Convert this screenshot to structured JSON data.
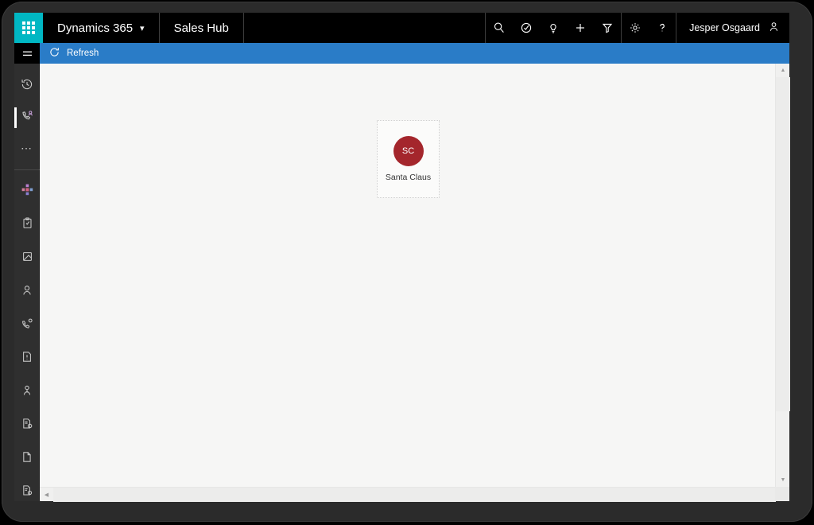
{
  "app": {
    "waffle_icon": "waffle-grid-icon",
    "brand": "Dynamics 365",
    "brand_chevron": "chevron-down-icon",
    "app_name": "Sales Hub"
  },
  "topbar": {
    "icons": [
      {
        "name": "search-icon",
        "label": "Search"
      },
      {
        "name": "assistant-icon",
        "label": "Relationship assistant"
      },
      {
        "name": "lightbulb-icon",
        "label": "Insights"
      },
      {
        "name": "plus-icon",
        "label": "Quick create"
      },
      {
        "name": "filter-icon",
        "label": "Filter"
      }
    ],
    "settings_icons": [
      {
        "name": "gear-icon",
        "label": "Settings"
      },
      {
        "name": "question-icon",
        "label": "Help"
      }
    ],
    "user": {
      "name": "Jesper Osgaard",
      "avatar_icon": "person-icon"
    }
  },
  "rail": {
    "hamburger_icon": "hamburger-icon",
    "items": [
      {
        "name": "sidebar-item-recent",
        "icon": "clock-icon",
        "label": "Recent",
        "active": false
      },
      {
        "name": "sidebar-item-pinned",
        "icon": "phone-person-icon",
        "label": "Pinned",
        "active": true
      },
      {
        "name": "sidebar-item-more",
        "icon": "ellipsis-icon",
        "label": "More",
        "active": false
      },
      {
        "name": "sidebar-item-dashboards",
        "icon": "dashboard-icon",
        "label": "Dashboards",
        "active": false
      },
      {
        "name": "sidebar-item-activities",
        "icon": "clipboard-icon",
        "label": "Activities",
        "active": false
      },
      {
        "name": "sidebar-item-accounts",
        "icon": "building-icon",
        "label": "Accounts",
        "active": false
      },
      {
        "name": "sidebar-item-contacts",
        "icon": "person-icon",
        "label": "Contacts",
        "active": false
      },
      {
        "name": "sidebar-item-leads",
        "icon": "phone-gear-icon",
        "label": "Leads",
        "active": false
      },
      {
        "name": "sidebar-item-opportunities",
        "icon": "note-icon",
        "label": "Opportunities",
        "active": false
      },
      {
        "name": "sidebar-item-competitors",
        "icon": "person-outline-icon",
        "label": "Competitors",
        "active": false
      },
      {
        "name": "sidebar-item-quotes",
        "icon": "doc-gear-icon",
        "label": "Quotes",
        "active": false
      },
      {
        "name": "sidebar-item-orders",
        "icon": "document-icon",
        "label": "Orders",
        "active": false
      },
      {
        "name": "sidebar-item-invoices",
        "icon": "doc-badge-icon",
        "label": "Invoices",
        "active": false
      }
    ]
  },
  "commandbar": {
    "refresh_icon": "refresh-icon",
    "refresh_label": "Refresh"
  },
  "content": {
    "card": {
      "initials": "SC",
      "name": "Santa Claus",
      "avatar_color": "#a4262c"
    }
  },
  "scrollbars": {
    "up_arrow": "chevron-up-icon",
    "down_arrow": "chevron-down-icon",
    "left_arrow": "chevron-left-icon",
    "right_arrow": "chevron-right-icon"
  },
  "colors": {
    "topbar_bg": "#000000",
    "waffle_bg": "#00b7c3",
    "commandbar_bg": "#2a7cc7",
    "rail_bg": "#2f2f2f",
    "content_bg": "#f6f6f5",
    "bezel": "#2b2b2b"
  }
}
